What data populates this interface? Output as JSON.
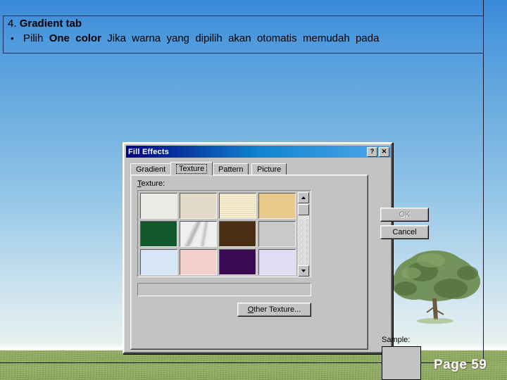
{
  "slide": {
    "header": {
      "line1_number": "4.",
      "line1_title": "Gradient tab",
      "bullet_marker": "•",
      "bullet_words": [
        {
          "t": "Pilih",
          "bold": false
        },
        {
          "t": "One",
          "bold": true
        },
        {
          "t": "color",
          "bold": true
        },
        {
          "t": "Jika",
          "bold": false
        },
        {
          "t": "warna",
          "bold": false
        },
        {
          "t": "yang",
          "bold": false
        },
        {
          "t": "dipilih",
          "bold": false
        },
        {
          "t": "akan",
          "bold": false
        },
        {
          "t": "otomatis",
          "bold": false
        },
        {
          "t": "memudah",
          "bold": false
        },
        {
          "t": "pada",
          "bold": false
        }
      ]
    },
    "page_label": "Page 59",
    "colors": {
      "sky_top": "#3a8ad9",
      "sky_bottom": "#dfe8e2",
      "grass": "#8cab5c",
      "textbox_border": "#1c2a5e",
      "page_number_color": "#ffffff"
    }
  },
  "dialog": {
    "title": "Fill Effects",
    "titlebar_color_left": "#000082",
    "titlebar_color_right": "#4fa8e8",
    "help_button": "?",
    "close_button": "✕",
    "tabs": [
      {
        "label": "Gradient",
        "selected": false
      },
      {
        "label": "Texture",
        "selected": true
      },
      {
        "label": "Pattern",
        "selected": false
      },
      {
        "label": "Picture",
        "selected": false
      }
    ],
    "texture_label": "Texture:",
    "textures": [
      {
        "name": "newsprint",
        "color": "#eceae4"
      },
      {
        "name": "recycled-paper",
        "color": "#e3dac7"
      },
      {
        "name": "parchment",
        "color": "#f6edd0"
      },
      {
        "name": "sand",
        "color": "#e9c88b"
      },
      {
        "name": "green-marble",
        "color": "#11592a"
      },
      {
        "name": "white-marble",
        "color": "#efefee"
      },
      {
        "name": "brown-marble",
        "color": "#4b2f12"
      },
      {
        "name": "granite",
        "color": "#c9c9c9"
      },
      {
        "name": "blue-tissue-paper",
        "color": "#d7e6f6"
      },
      {
        "name": "pink-tissue-paper",
        "color": "#f2cfcb"
      },
      {
        "name": "purple-mesh",
        "color": "#3a0a55"
      },
      {
        "name": "bouquet",
        "color": "#dfdcf4"
      }
    ],
    "scroll": {
      "up": "▲",
      "down": "▼"
    },
    "name_field_value": "",
    "other_texture_button": "Other Texture...",
    "other_texture_accel": "O",
    "ok_button": "OK",
    "ok_enabled": false,
    "cancel_button": "Cancel",
    "sample_label": "Sample:",
    "sample_value": ""
  }
}
